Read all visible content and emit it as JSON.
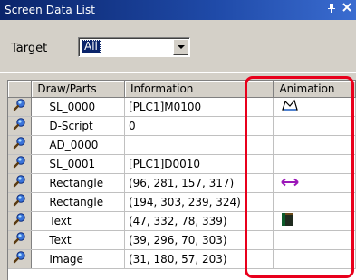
{
  "window": {
    "title": "Screen Data List",
    "pin_glyph": "p",
    "close_glyph": "×"
  },
  "filter": {
    "label": "Target",
    "value": "All"
  },
  "columns": [
    "Draw/Parts",
    "Information",
    "Animation"
  ],
  "rows": [
    {
      "parts": "SL_0000",
      "info": "[PLC1]M0100",
      "animation": "shape-outline-icon"
    },
    {
      "parts": "D-Script",
      "info": "0",
      "animation": ""
    },
    {
      "parts": "AD_0000",
      "info": "",
      "animation": ""
    },
    {
      "parts": "SL_0001",
      "info": "[PLC1]D0010",
      "animation": ""
    },
    {
      "parts": "Rectangle",
      "info": "(96, 281, 157, 317)",
      "animation": "move-horizontal-icon"
    },
    {
      "parts": "Rectangle",
      "info": "(194, 303, 239, 324)",
      "animation": ""
    },
    {
      "parts": "Text",
      "info": "(47, 332, 78, 339)",
      "animation": "book-icon"
    },
    {
      "parts": "Text",
      "info": "(39, 296, 70, 303)",
      "animation": ""
    },
    {
      "parts": "Image",
      "info": "(31, 180, 57, 203)",
      "animation": ""
    }
  ],
  "colors": {
    "title_bar": "#0a246a",
    "highlight": "#e8001c",
    "move_icon": "#9b17b8"
  }
}
